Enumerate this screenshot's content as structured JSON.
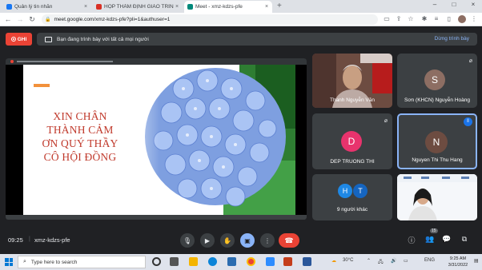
{
  "browser": {
    "tabs": [
      {
        "title": "Quản lý tin nhắn",
        "active": false,
        "favicon_color": "#1877f2"
      },
      {
        "title": "HỌP THẨM ĐỊNH GIÁO TRÌNH",
        "active": false,
        "favicon_color": "#d93025"
      },
      {
        "title": "Meet - xmz-kdzs-pfe",
        "active": true,
        "favicon_color": "#00897b"
      }
    ],
    "tab_close": "×",
    "new_tab": "+",
    "window_controls": {
      "minimize": "–",
      "maximize": "□",
      "close": "×"
    },
    "url": "meet.google.com/xmz-kdzs-pfe?pli=1&authuser=1"
  },
  "presenting_bar": {
    "record_label": "GHI",
    "info_text": "Bạn đang trình bày với tất cả mọi người",
    "stop_label": "Dừng trình bày"
  },
  "slide": {
    "thanks_lines": [
      "XIN CHÂN",
      "THÀNH CẢM",
      "ƠN QUÝ THẦY",
      "CÔ HỘI ĐỒNG"
    ],
    "accent_color": "#f2913c",
    "text_color": "#c0392b"
  },
  "participants": [
    {
      "name": "Thanh Nguyễn Văn",
      "type": "video"
    },
    {
      "name": "Sơn (KHCN) Nguyễn Hoàng",
      "initial": "S",
      "avatar_color": "#8d6e63",
      "muted": true
    },
    {
      "name": "DEP TRUONG THI",
      "initial": "D",
      "avatar_color": "#e8336d",
      "muted": true
    },
    {
      "name": "Nguyen Thi Thu Hang",
      "initial": "N",
      "avatar_color": "#6d4c41",
      "speaking": true
    },
    {
      "name": "9 người khác",
      "initials": [
        "H",
        "T"
      ],
      "avatar_colors": [
        "#1e88e5",
        "#1565c0"
      ]
    },
    {
      "name": "",
      "type": "video"
    }
  ],
  "meeting_bar": {
    "time": "09:25",
    "separator": "|",
    "code": "xmz-kdzs-pfe",
    "participant_count": "15"
  },
  "taskbar": {
    "search_placeholder": "Type here to search",
    "temperature": "30°C",
    "language": "ENG",
    "time": "9:25 AM",
    "date": "3/31/2022"
  }
}
